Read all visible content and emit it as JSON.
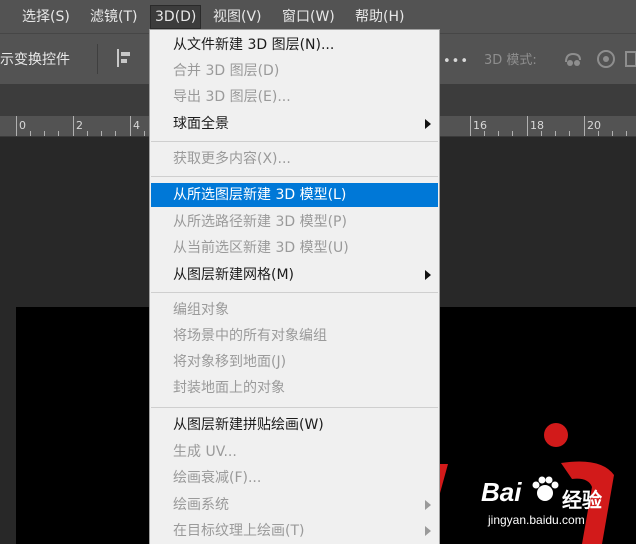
{
  "menubar": {
    "items": [
      {
        "label": "选择(S)"
      },
      {
        "label": "滤镜(T)"
      },
      {
        "label": "3D(D)"
      },
      {
        "label": "视图(V)"
      },
      {
        "label": "窗口(W)"
      },
      {
        "label": "帮助(H)"
      }
    ]
  },
  "options": {
    "transform_label": "示变换控件",
    "dots": "•••",
    "mode_label": "3D 模式:",
    "icons": [
      "align-left-icon",
      "rotate-3d-icon",
      "roll-3d-icon",
      "drag-3d-icon"
    ]
  },
  "ruler": {
    "labels": [
      "0",
      "2",
      "4",
      "16",
      "18",
      "20"
    ]
  },
  "menu_3d": {
    "items": [
      {
        "label": "从文件新建 3D 图层(N)...",
        "enabled": true
      },
      {
        "label": "合并 3D 图层(D)",
        "enabled": false
      },
      {
        "label": "导出 3D 图层(E)...",
        "enabled": false
      },
      {
        "label": "球面全景",
        "enabled": true,
        "submenu": true
      },
      {
        "label": "获取更多内容(X)...",
        "enabled": false
      },
      {
        "label": "从所选图层新建 3D 模型(L)",
        "enabled": true,
        "highlighted": true
      },
      {
        "label": "从所选路径新建 3D 模型(P)",
        "enabled": false
      },
      {
        "label": "从当前选区新建 3D 模型(U)",
        "enabled": false
      },
      {
        "label": "从图层新建网格(M)",
        "enabled": true,
        "submenu": true
      },
      {
        "label": "编组对象",
        "enabled": false
      },
      {
        "label": "将场景中的所有对象编组",
        "enabled": false
      },
      {
        "label": "将对象移到地面(J)",
        "enabled": false
      },
      {
        "label": "封装地面上的对象",
        "enabled": false
      },
      {
        "label": "从图层新建拼贴绘画(W)",
        "enabled": true
      },
      {
        "label": "生成 UV...",
        "enabled": false
      },
      {
        "label": "绘画衰减(F)...",
        "enabled": false
      },
      {
        "label": "绘画系统",
        "enabled": false,
        "submenu": true
      },
      {
        "label": "在目标纹理上绘画(T)",
        "enabled": false,
        "submenu": true
      }
    ]
  },
  "watermark": {
    "brand": "Bai",
    "brand_suffix": "经验",
    "url": "jingyan.baidu.com"
  },
  "colors": {
    "menu_highlight": "#0078d7",
    "canvas_text": "#d21a1a"
  }
}
